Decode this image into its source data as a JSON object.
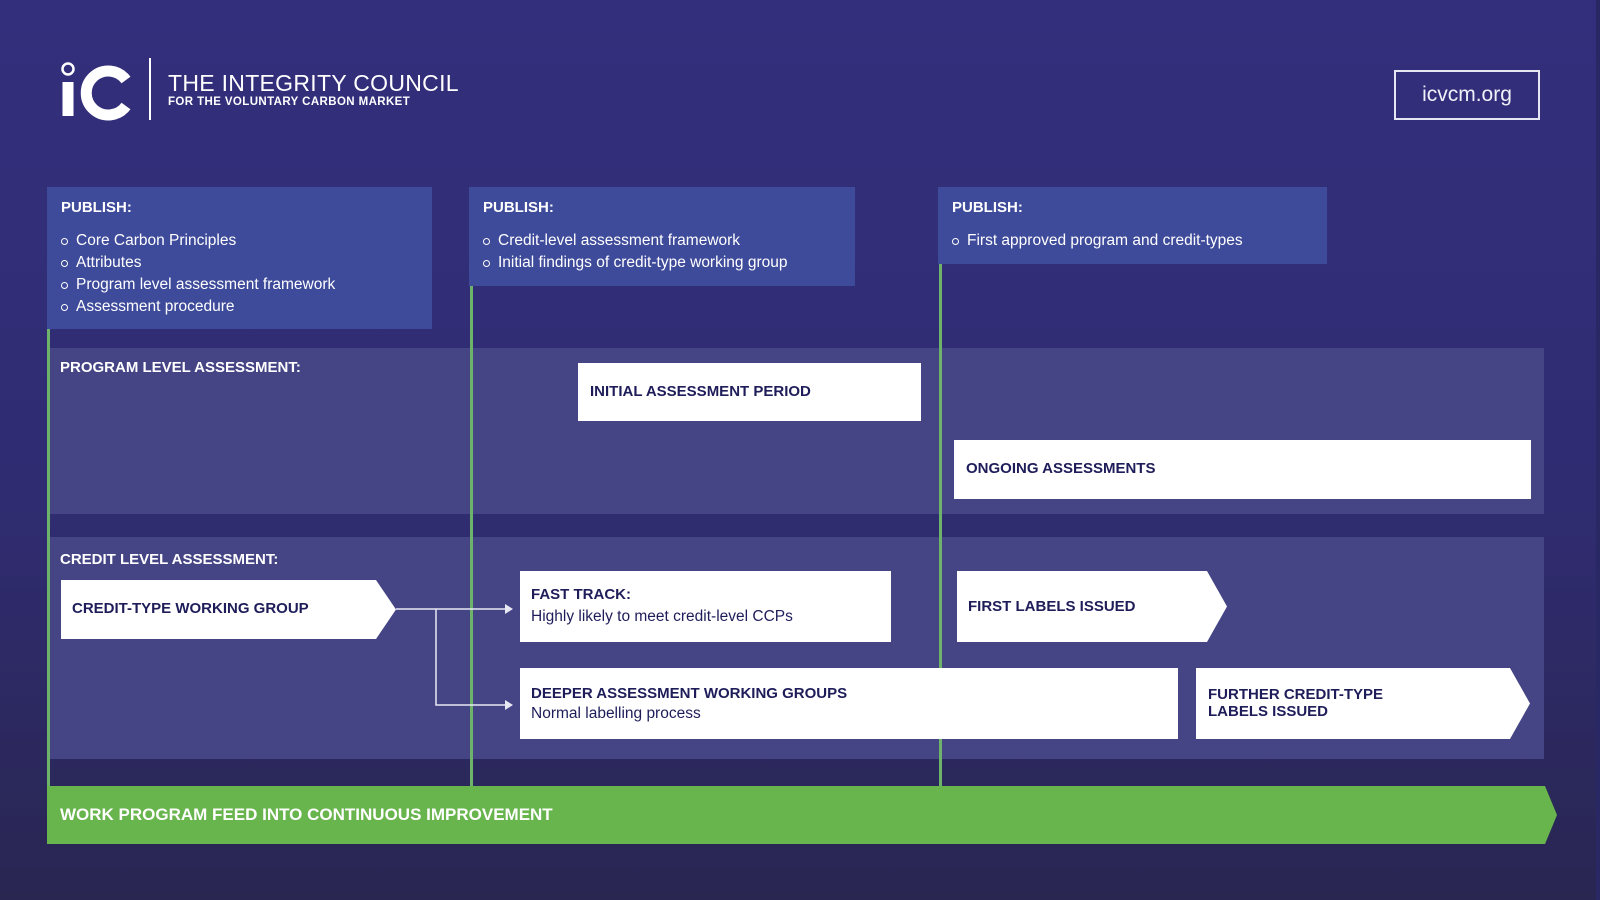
{
  "header": {
    "logo_text": "iC",
    "org_name": "THE INTEGRITY COUNCIL",
    "org_subtitle": "FOR THE VOLUNTARY CARBON MARKET",
    "website": "icvcm.org"
  },
  "publish": [
    {
      "heading": "PUBLISH:",
      "items": [
        "Core Carbon Principles",
        "Attributes",
        "Program level assessment framework",
        "Assessment procedure"
      ]
    },
    {
      "heading": "PUBLISH:",
      "items": [
        "Credit-level assessment framework",
        "Initial findings of credit-type working group"
      ]
    },
    {
      "heading": "PUBLISH:",
      "items": [
        "First approved program and credit-types"
      ]
    }
  ],
  "program_level": {
    "label": "PROGRAM LEVEL ASSESSMENT:",
    "initial": "INITIAL ASSESSMENT PERIOD",
    "ongoing": "ONGOING ASSESSMENTS"
  },
  "credit_level": {
    "label": "CREDIT LEVEL ASSESSMENT:",
    "working_group": "CREDIT-TYPE WORKING GROUP",
    "fast_track_title": "FAST TRACK:",
    "fast_track_desc": "Highly likely to meet credit-level CCPs",
    "first_labels": "FIRST LABELS ISSUED",
    "deeper_title": "DEEPER ASSESSMENT WORKING GROUPS",
    "deeper_desc": "Normal labelling process",
    "further_line1": "FURTHER CREDIT-TYPE",
    "further_line2": "LABELS ISSUED"
  },
  "footer_bar": "WORK PROGRAM FEED INTO CONTINUOUS IMPROVEMENT",
  "colors": {
    "background": "#332f7c",
    "publish_box": "#3e4a9a",
    "band": "#454485",
    "milestone_green": "#6db46a",
    "footer_green": "#68b44d",
    "box_text": "#1e1d5a"
  }
}
